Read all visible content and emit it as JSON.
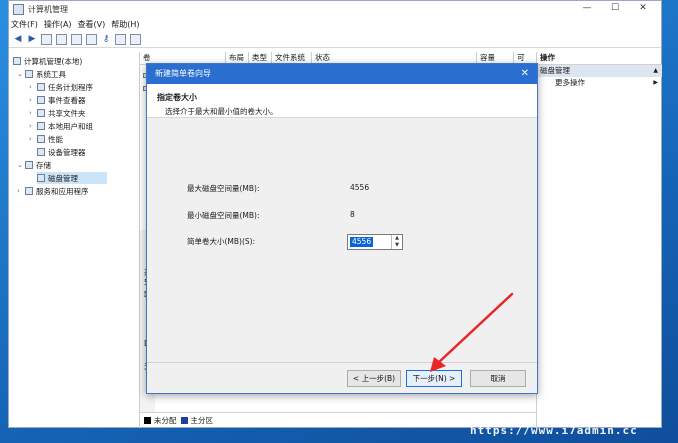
{
  "window": {
    "title": "计算机管理",
    "controls": {
      "minimize": "—",
      "maximize": "☐",
      "close": "✕"
    }
  },
  "menubar": [
    "文件(F)",
    "操作(A)",
    "查看(V)",
    "帮助(H)"
  ],
  "tree": {
    "root": "计算机管理(本地)",
    "system_tools": "系统工具",
    "task_scheduler": "任务计划程序",
    "event_viewer": "事件查看器",
    "shared_folders": "共享文件夹",
    "local_users": "本地用户和组",
    "performance": "性能",
    "device_manager": "设备管理器",
    "storage": "存储",
    "disk_management": "磁盘管理",
    "services_apps": "服务和应用程序"
  },
  "columns": [
    "卷",
    "布局",
    "类型",
    "文件系统",
    "状态",
    "容量",
    "可"
  ],
  "disk_fragments": {
    "a": "基",
    "b": "59",
    "c": "联",
    "d": "DV",
    "e": "无"
  },
  "legend": {
    "unallocated": "未分配",
    "primary": "主分区"
  },
  "actions": {
    "header": "操作",
    "selected": "磁盘管理",
    "more": "更多操作"
  },
  "dialog": {
    "title": "新建简单卷向导",
    "close": "✕",
    "heading": "指定卷大小",
    "subheading": "选择介于最大和最小值的卷大小。",
    "max_label": "最大磁盘空间量(MB):",
    "max_value": "4556",
    "min_label": "最小磁盘空间量(MB):",
    "min_value": "8",
    "size_label": "简单卷大小(MB)(S):",
    "size_value": "4556",
    "back": "< 上一步(B)",
    "next": "下一步(N) >",
    "cancel": "取消"
  },
  "watermark": "https://www.i7admin.cc",
  "colors": {
    "accent": "#2a6fd0",
    "arrow": "#e8262a",
    "unallocated": "#000000",
    "primary": "#1f3f9e"
  }
}
